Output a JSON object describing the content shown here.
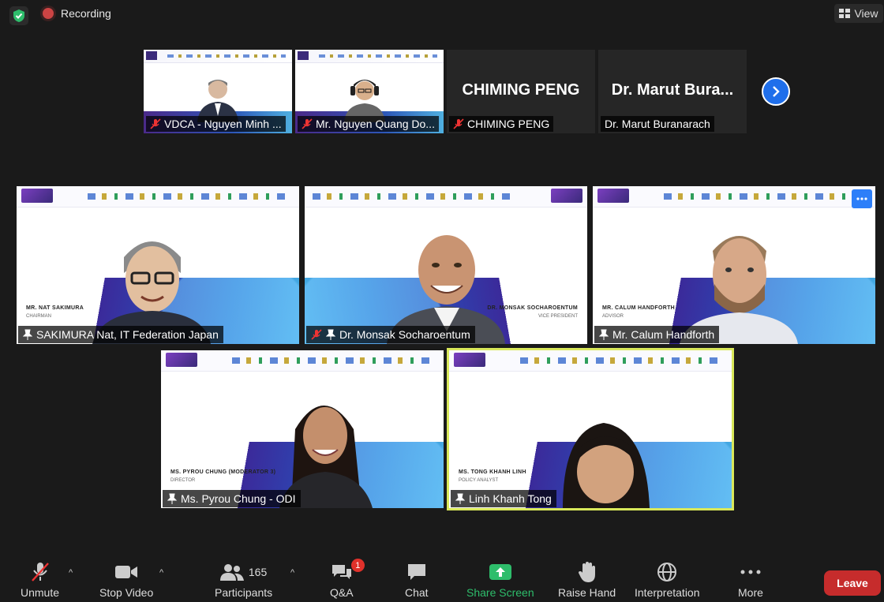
{
  "topbar": {
    "recording_label": "Recording",
    "view_label": "View"
  },
  "thumbnails": [
    {
      "label": "VDCA - Nguyen Minh ...",
      "muted": true
    },
    {
      "label": "Mr. Nguyen Quang Do...",
      "muted": true
    },
    {
      "label": "CHIMING PENG",
      "muted": true,
      "big_name": "CHIMING PENG"
    },
    {
      "label": "Dr. Marut Buranarach",
      "muted": false,
      "big_name": "Dr. Marut  Bura..."
    }
  ],
  "gallery": [
    {
      "label": "SAKIMURA Nat, IT Federation Japan",
      "slide_name": "MR. NAT SAKIMURA",
      "slide_role": "CHAIRMAN"
    },
    {
      "label": "Dr. Monsak Socharoentum",
      "slide_name": "DR. MONSAK SOCHAROENTUM",
      "slide_role": "VICE PRESIDENT"
    },
    {
      "label": "Mr. Calum Handforth",
      "slide_name": "MR. CALUM HANDFORTH",
      "slide_role": "ADVISOR"
    },
    {
      "label": "Ms. Pyrou Chung - ODI",
      "slide_name": "MS. PYROU CHUNG (MODERATOR 3)",
      "slide_role": "DIRECTOR"
    },
    {
      "label": "Linh Khanh Tong",
      "slide_name": "MS. TONG KHANH LINH",
      "slide_role": "POLICY ANALYST"
    }
  ],
  "toolbar": {
    "unmute": "Unmute",
    "stop_video": "Stop Video",
    "participants": "Participants",
    "participants_count": "165",
    "qa": "Q&A",
    "qa_badge": "1",
    "chat": "Chat",
    "share_screen": "Share Screen",
    "raise_hand": "Raise Hand",
    "interpretation": "Interpretation",
    "more": "More",
    "leave": "Leave"
  },
  "colors": {
    "background": "#1a1a1a",
    "share_green": "#2ebd6b",
    "leave_red": "#c62c2c",
    "accent_blue": "#1f6feb",
    "active_speaker": "#d9e85a"
  }
}
